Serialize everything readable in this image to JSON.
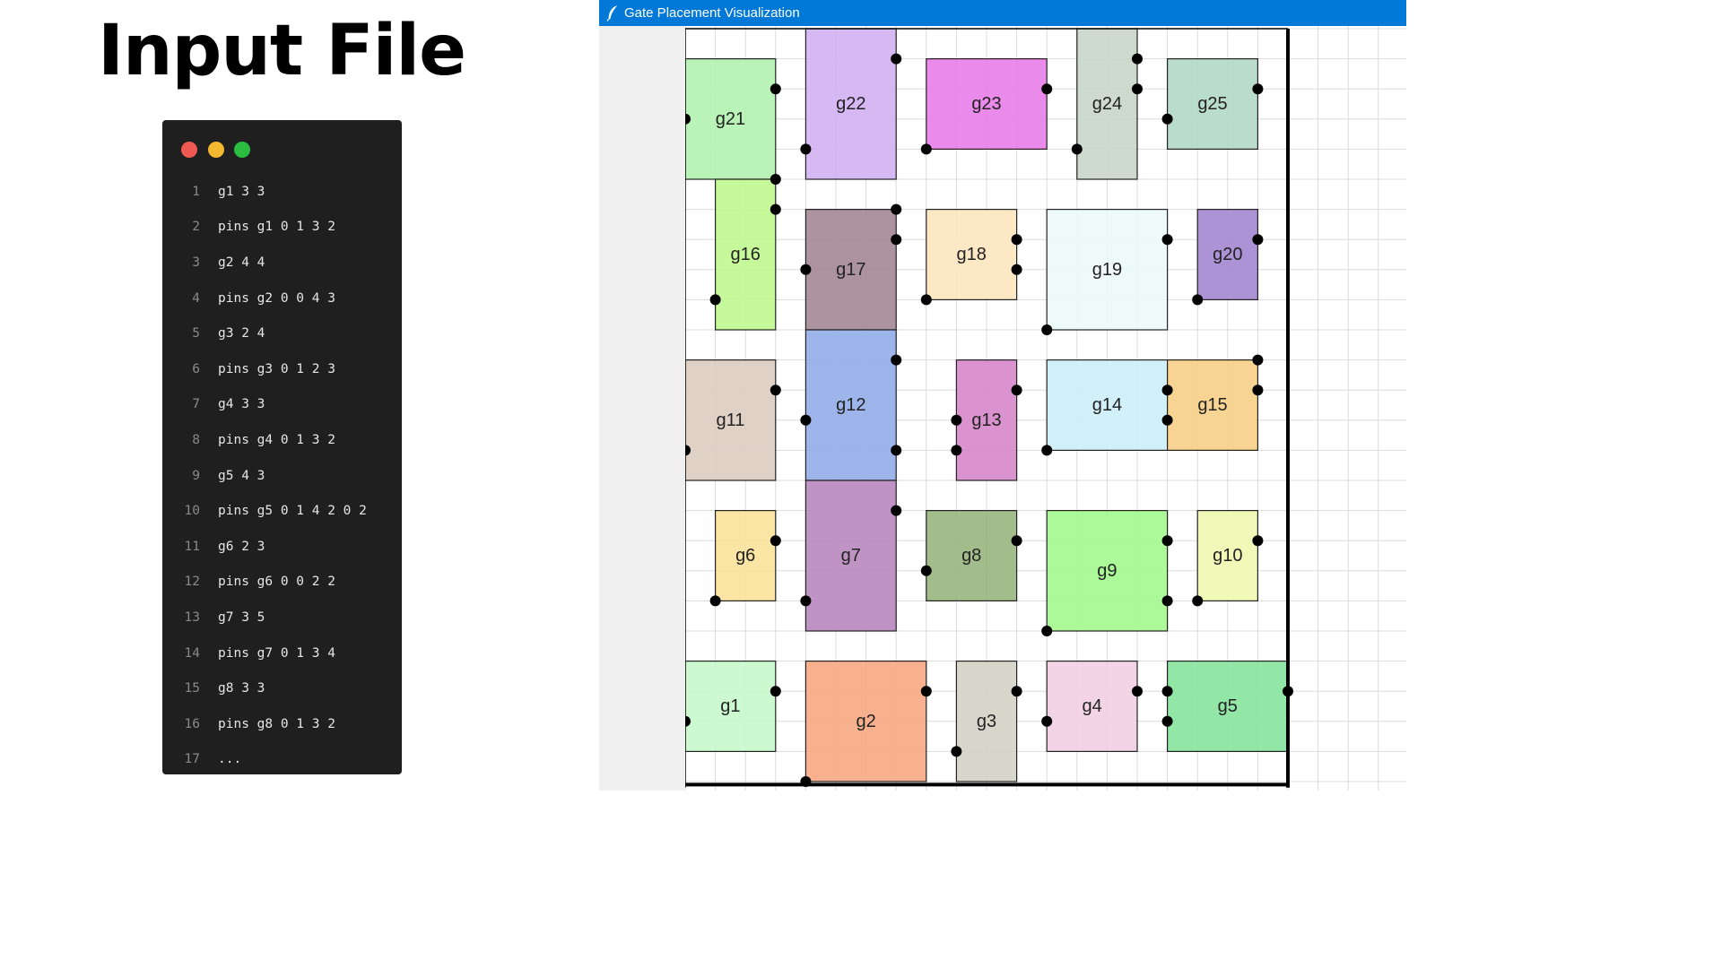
{
  "slide": {
    "title": "Input File"
  },
  "editor": {
    "traffic_lights": {
      "close": "#ee5a52",
      "minimize": "#f5b931",
      "maximize": "#2bbd3f"
    },
    "lines": [
      {
        "num": "1",
        "text": "g1 3 3"
      },
      {
        "num": "2",
        "text": "pins g1 0 1 3 2"
      },
      {
        "num": "3",
        "text": "g2 4 4"
      },
      {
        "num": "4",
        "text": "pins g2 0 0 4 3"
      },
      {
        "num": "5",
        "text": "g3 2 4"
      },
      {
        "num": "6",
        "text": "pins g3 0 1 2 3"
      },
      {
        "num": "7",
        "text": "g4 3 3"
      },
      {
        "num": "8",
        "text": "pins g4 0 1 3 2"
      },
      {
        "num": "9",
        "text": "g5 4 3"
      },
      {
        "num": "10",
        "text": "pins g5 0 1 4 2 0 2"
      },
      {
        "num": "11",
        "text": "g6 2 3"
      },
      {
        "num": "12",
        "text": "pins g6 0 0 2 2"
      },
      {
        "num": "13",
        "text": "g7 3 5"
      },
      {
        "num": "14",
        "text": "pins g7 0 1 3 4"
      },
      {
        "num": "15",
        "text": "g8 3 3"
      },
      {
        "num": "16",
        "text": "pins g8 0 1 3 2"
      },
      {
        "num": "17",
        "text": "..."
      }
    ]
  },
  "window": {
    "title": "Gate Placement Visualization",
    "icon": "feather-icon"
  },
  "board": {
    "gates": [
      {
        "name": "g21",
        "color": "#b2f2b0",
        "label": "g21"
      },
      {
        "name": "g22",
        "color": "#d2b0f2",
        "label": "g22"
      },
      {
        "name": "g23",
        "color": "#e87de8",
        "label": "g23"
      },
      {
        "name": "g24",
        "color": "#c8d6c8",
        "label": "g24"
      },
      {
        "name": "g25",
        "color": "#b2d8c8",
        "label": "g25"
      },
      {
        "name": "g16",
        "color": "#c0f88e",
        "label": "g16"
      },
      {
        "name": "g17",
        "color": "#a38795",
        "label": "g17"
      },
      {
        "name": "g18",
        "color": "#fde5c0",
        "label": "g18"
      },
      {
        "name": "g19",
        "color": "#ecfafa",
        "label": "g19"
      },
      {
        "name": "g20",
        "color": "#a387d2",
        "label": "g20"
      },
      {
        "name": "g11",
        "color": "#dcccc0",
        "label": "g11"
      },
      {
        "name": "g12",
        "color": "#92ade8",
        "label": "g12"
      },
      {
        "name": "g13",
        "color": "#d787ca",
        "label": "g13"
      },
      {
        "name": "g14",
        "color": "#cdeefa",
        "label": "g14"
      },
      {
        "name": "g15",
        "color": "#f7cf87",
        "label": "g15"
      },
      {
        "name": "g6",
        "color": "#fbe29a",
        "label": "g6"
      },
      {
        "name": "g7",
        "color": "#b887bd",
        "label": "g7"
      },
      {
        "name": "g8",
        "color": "#98b57f",
        "label": "g8"
      },
      {
        "name": "g9",
        "color": "#a2f88e",
        "label": "g9"
      },
      {
        "name": "g10",
        "color": "#f0f8b0",
        "label": "g10"
      },
      {
        "name": "g1",
        "color": "#c8f8cc",
        "label": "g1"
      },
      {
        "name": "g2",
        "color": "#f7a882",
        "label": "g2"
      },
      {
        "name": "g3",
        "color": "#d4d2c4",
        "label": "g3"
      },
      {
        "name": "g4",
        "color": "#f2cfe2",
        "label": "g4"
      },
      {
        "name": "g5",
        "color": "#86e49d",
        "label": "g5"
      }
    ]
  }
}
